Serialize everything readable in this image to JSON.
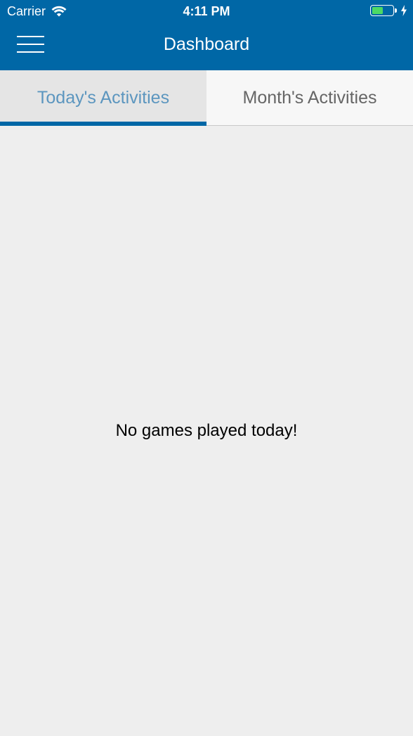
{
  "status_bar": {
    "carrier": "Carrier",
    "time": "4:11 PM",
    "battery_icon": "battery-charging-icon",
    "wifi_icon": "wifi-icon"
  },
  "header": {
    "title": "Dashboard",
    "menu_icon": "hamburger-menu-icon",
    "background_color": "#0067a6"
  },
  "tabs": [
    {
      "label": "Today's Activities",
      "active": true
    },
    {
      "label": "Month's Activities",
      "active": false
    }
  ],
  "main": {
    "empty_message": "No games played today!"
  },
  "colors": {
    "accent": "#0067a6",
    "active_tab_text": "#5c96bf",
    "inactive_tab_text": "#666666",
    "background": "#eeeeee"
  }
}
